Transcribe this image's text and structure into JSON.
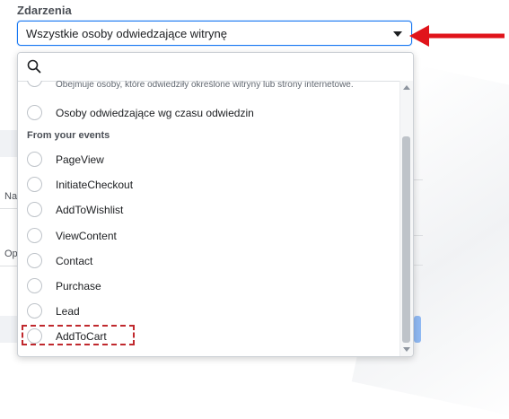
{
  "section": {
    "label": "Zdarzenia"
  },
  "select": {
    "value": "Wszystkie osoby odwiedzające witrynę"
  },
  "search": {
    "placeholder": ""
  },
  "options": {
    "partial_desc": "Obejmuje osoby, które odwiedziły określone witryny lub strony internetowe.",
    "time_spent": "Osoby odwiedzające wg czasu odwiedzin"
  },
  "group": {
    "header": "From your events"
  },
  "events": [
    {
      "label": "PageView"
    },
    {
      "label": "InitiateCheckout"
    },
    {
      "label": "AddToWishlist"
    },
    {
      "label": "ViewContent"
    },
    {
      "label": "Contact"
    },
    {
      "label": "Purchase"
    },
    {
      "label": "Lead"
    },
    {
      "label": "AddToCart"
    }
  ],
  "background_fragments": {
    "na": "Na",
    "op": "Op",
    "paren": "("
  },
  "colors": {
    "accent": "#1877f2",
    "annotation_red": "#e0141b",
    "highlight_dashed": "#c0282d"
  },
  "icons": {
    "search": "search-icon",
    "caret": "caret-down-icon",
    "arrow": "red-arrow-left-icon"
  }
}
